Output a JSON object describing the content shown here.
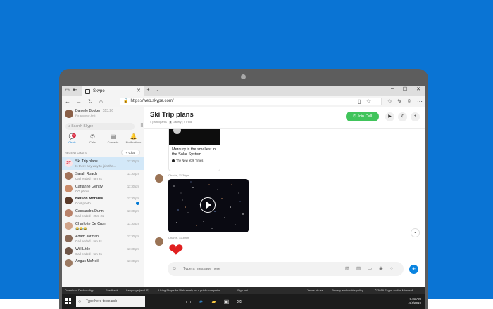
{
  "browser": {
    "tab_title": "Skype",
    "url": "https://web.skype.com/"
  },
  "profile": {
    "name": "Danielle Booker",
    "balance": "$13.26",
    "status": "Fix sponsor-first"
  },
  "search": {
    "placeholder": "Search Skype"
  },
  "nav_tabs": [
    {
      "label": "Chats",
      "icon": "chat-bubbles-icon",
      "badge": "1"
    },
    {
      "label": "Calls",
      "icon": "phone-icon"
    },
    {
      "label": "Contacts",
      "icon": "contacts-icon"
    },
    {
      "label": "Notifications",
      "icon": "bell-icon"
    }
  ],
  "recent_label": "RECENT CHATS",
  "new_chat_label": "+ Chat",
  "chats": [
    {
      "initials": "ST",
      "name": "Ski Trip plans",
      "preview": "Is there any way to join the...",
      "time": "11:30 pm"
    },
    {
      "name": "Sarah Roach",
      "preview": "Call ended - 5m 2s",
      "time": "11:30 pm"
    },
    {
      "name": "Carianne Gentry",
      "preview": "CG photo",
      "time": "11:30 pm"
    },
    {
      "name": "Nelson Morales",
      "preview": "Cool photo",
      "time": "11:30 pm"
    },
    {
      "name": "Cassandra Dunn",
      "preview": "Call ended - 25m 2s",
      "time": "11:30 pm"
    },
    {
      "name": "Charlotte De Crum",
      "preview": "😂😂😂",
      "time": "11:30 pm"
    },
    {
      "name": "Adam Jarman",
      "preview": "Call ended - 5m 2s",
      "time": "11:30 pm"
    },
    {
      "name": "Will Little",
      "preview": "Call ended - 5m 2s",
      "time": "11:30 pm"
    },
    {
      "name": "Angus McNeil",
      "preview": "",
      "time": "11:30 pm"
    }
  ],
  "conversation": {
    "title": "Ski Trip plans",
    "participants": "4 participants",
    "gallery": "Gallery",
    "find": "Find",
    "join_call_label": "Join Call",
    "link_card": {
      "text": "Mercury is the smallest in the Solar System",
      "source": "The New York Times"
    },
    "messages": [
      {
        "sender_time": "Charlie, 11:30pm"
      },
      {
        "sender_time": "Charlie, 11:30pm"
      }
    ],
    "composer_placeholder": "Type a message here"
  },
  "footer": {
    "download": "Download Desktop App",
    "feedback": "Feedback",
    "language": "Language (en-US)",
    "notice": "Using Skype for Web safely on a public computer",
    "signout": "Sign out",
    "terms": "Terms of use",
    "privacy": "Privacy and cookie policy",
    "copyright": "© 2019 Skype and/or Microsoft"
  },
  "taskbar": {
    "search_placeholder": "Type here to search",
    "time": "9:50 AM",
    "date": "4/4/2019"
  },
  "colors": {
    "background": "#0a74d4",
    "skype_blue": "#0078d4",
    "join_call": "#40c45b",
    "heart": "#e02020"
  }
}
